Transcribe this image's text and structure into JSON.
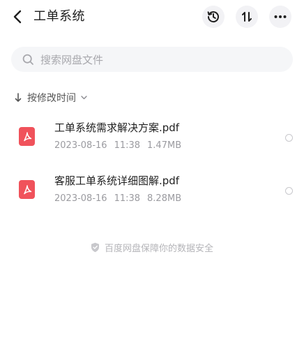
{
  "header": {
    "title": "工单系统",
    "icons": {
      "back": "chevron-left-icon",
      "history": "history-icon",
      "sort": "sort-icon",
      "more": "more-icon"
    }
  },
  "search": {
    "placeholder": "搜索网盘文件",
    "icon": "search-icon"
  },
  "sort": {
    "label": "按修改时间",
    "icon": "arrow-down-icon"
  },
  "files": [
    {
      "name": "工单系统需求解决方案.pdf",
      "date": "2023-08-16",
      "time": "11:38",
      "size": "1.47MB",
      "icon": "pdf-icon"
    },
    {
      "name": "客服工单系统详细图解.pdf",
      "date": "2023-08-16",
      "time": "11:38",
      "size": "8.28MB",
      "icon": "pdf-icon"
    }
  ],
  "footer": {
    "text": "百度网盘保障你的数据安全",
    "icon": "shield-icon"
  },
  "colors": {
    "pdf": "#f0525b",
    "button_bg": "#f2f2f5",
    "search_bg": "#f5f6f8"
  }
}
